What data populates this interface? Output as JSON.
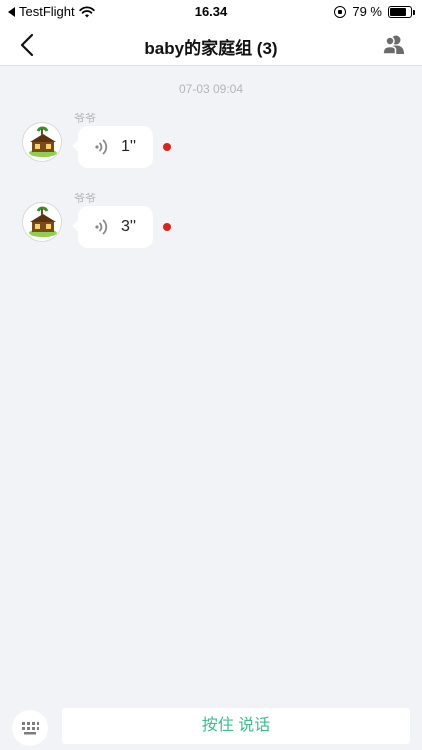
{
  "status_bar": {
    "back_app": "TestFlight",
    "time": "16.34",
    "battery": "79 %",
    "battery_level": 0.79
  },
  "nav": {
    "title": "baby的家庭组 (3)"
  },
  "chat": {
    "timestamp": "07-03 09:04",
    "messages": [
      {
        "sender": "爷爷",
        "duration": "1''",
        "unread": true
      },
      {
        "sender": "爷爷",
        "duration": "3''",
        "unread": true
      }
    ]
  },
  "input_bar": {
    "talk_label": "按住 说话"
  },
  "colors": {
    "accent": "#3bbf8f",
    "unread": "#e0201b",
    "background": "#f2f3f7"
  },
  "icons": [
    "back-chevron-icon",
    "group-members-icon",
    "voice-wave-icon",
    "keyboard-icon",
    "wifi-icon"
  ]
}
